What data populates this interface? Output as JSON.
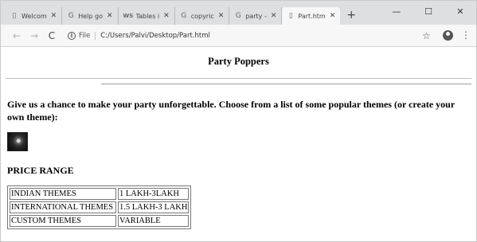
{
  "browser": {
    "tabs": [
      {
        "icon": "page-icon",
        "title": "Welcom",
        "active": false
      },
      {
        "icon": "google-icon",
        "title": "Help go",
        "active": false
      },
      {
        "icon": "ws-icon",
        "title": "Tables i",
        "active": false
      },
      {
        "icon": "google-icon",
        "title": "copyric",
        "active": false
      },
      {
        "icon": "google-icon",
        "title": "party -",
        "active": false
      },
      {
        "icon": "page-icon",
        "title": "Part.htm",
        "active": true
      }
    ],
    "favicon_glyphs": {
      "page": "▯",
      "google": "G",
      "ws": "WS"
    },
    "new_tab": "+",
    "file_label": "File",
    "url": "C:/Users/Palvi/Desktop/Part.html"
  },
  "page": {
    "heading": "Party Poppers",
    "intro": "Give us a chance to make your party unforgettable. Choose from a list of some popular themes (or create your own theme):",
    "price_heading": "PRICE RANGE",
    "price_table": [
      [
        "INDIAN THEMES",
        "1 LAKH-3LAKH"
      ],
      [
        "INTERNATIONAL THEMES",
        "1.5 LAKH-3 LAKH"
      ],
      [
        "CUSTOM THEMES",
        "VARIABLE"
      ]
    ]
  }
}
